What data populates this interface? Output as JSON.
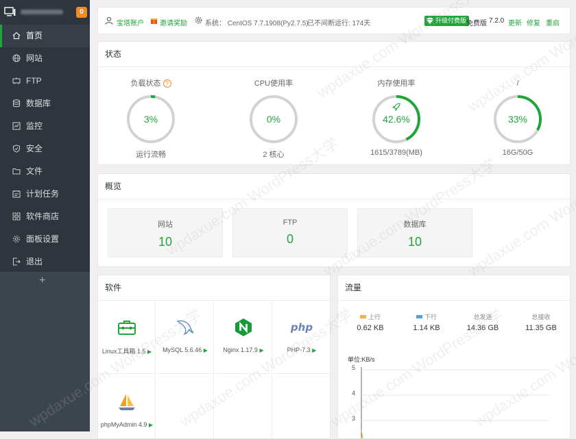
{
  "sidebar": {
    "badge": "0",
    "items": [
      {
        "label": "首页",
        "icon": "home-icon",
        "active": true
      },
      {
        "label": "网站",
        "icon": "globe-icon"
      },
      {
        "label": "FTP",
        "icon": "ftp-icon"
      },
      {
        "label": "数据库",
        "icon": "database-icon"
      },
      {
        "label": "监控",
        "icon": "monitor-icon"
      },
      {
        "label": "安全",
        "icon": "shield-icon"
      },
      {
        "label": "文件",
        "icon": "folder-icon"
      },
      {
        "label": "计划任务",
        "icon": "schedule-icon"
      },
      {
        "label": "软件商店",
        "icon": "apps-icon"
      },
      {
        "label": "面板设置",
        "icon": "gear-icon"
      },
      {
        "label": "退出",
        "icon": "logout-icon"
      }
    ],
    "add": "+"
  },
  "topbar": {
    "account": "宝塔账户",
    "invite": "邀请奖励",
    "system": "系统：  CentOS 7.7.1908(Py2.7.5)",
    "uptime": "已不间断运行: 174天",
    "upgrade": "升级付费版",
    "edition": "免费版",
    "version": "7.2.0",
    "update": "更新",
    "repair": "修复",
    "restart": "重启"
  },
  "status": {
    "title": "状态",
    "gauges": [
      {
        "label": "负载状态",
        "value": "3%",
        "percent": 3,
        "sub": "运行流畅",
        "help": "?"
      },
      {
        "label": "CPU使用率",
        "value": "0%",
        "percent": 0,
        "sub": "2 核心"
      },
      {
        "label": "内存使用率",
        "value": "42.6%",
        "percent": 42.6,
        "sub": "1615/3789(MB)",
        "rocket": true
      },
      {
        "label": "/",
        "value": "33%",
        "percent": 33,
        "sub": "16G/50G"
      }
    ]
  },
  "overview": {
    "title": "概览",
    "boxes": [
      {
        "name": "网站",
        "value": "10"
      },
      {
        "name": "FTP",
        "value": "0"
      },
      {
        "name": "数据库",
        "value": "10"
      }
    ]
  },
  "software": {
    "title": "软件",
    "items": [
      {
        "name": "Linux工具箱 1.5",
        "icon": "toolbox-icon"
      },
      {
        "name": "MySQL 5.6.46",
        "icon": "mysql-dolphin-icon"
      },
      {
        "name": "Nginx 1.17.9",
        "icon": "nginx-icon"
      },
      {
        "name": "PHP-7.3",
        "icon": "php-icon",
        "logo_text": "php"
      },
      {
        "name": "phpMyAdmin 4.9",
        "icon": "phpmyadmin-sailboat-icon"
      }
    ]
  },
  "traffic": {
    "title": "流量",
    "stats": [
      {
        "label": "上行",
        "value": "0.62 KB",
        "color": "#f4b04c"
      },
      {
        "label": "下行",
        "value": "1.14 KB",
        "color": "#52a2e6"
      },
      {
        "label": "总发送",
        "value": "14.36 GB"
      },
      {
        "label": "总接收",
        "value": "11.35 GB"
      }
    ],
    "unit": "单位:KB/s",
    "y_ticks": [
      "5",
      "4",
      "3"
    ]
  },
  "watermark": "wpdaxue.com  WordPress大学",
  "colors": {
    "accent": "#20a53a",
    "sidebar": "#3c444d",
    "sidebar_top": "#2f353d",
    "badge": "#f08a24"
  }
}
